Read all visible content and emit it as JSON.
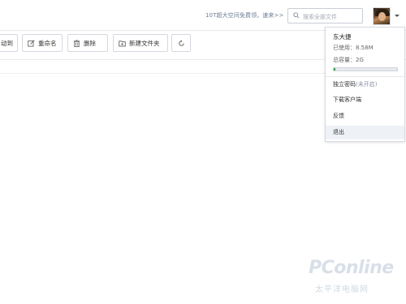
{
  "header": {
    "promo_text": "10T超大空间免费领，速来>>",
    "search_placeholder": "搜索全部文件"
  },
  "toolbar": {
    "move_label": "动到",
    "rename_label": "重命名",
    "delete_label": "删除",
    "new_folder_label": "新建文件夹"
  },
  "user_menu": {
    "username": "东大捷",
    "used_label": "已使用：8.58M",
    "total_label": "总容量：2G",
    "quota_fraction": 0.0042,
    "items": {
      "password": "独立密码",
      "password_note": "(未开启)",
      "client": "下载客户端",
      "feedback": "反馈",
      "logout": "退出"
    }
  },
  "watermark": {
    "brand": "PConline",
    "cn": "太平洋电脑网"
  },
  "colors": {
    "quota_fill": "#38a34a",
    "border": "#d4d9e0",
    "promo": "#6b7c93"
  }
}
